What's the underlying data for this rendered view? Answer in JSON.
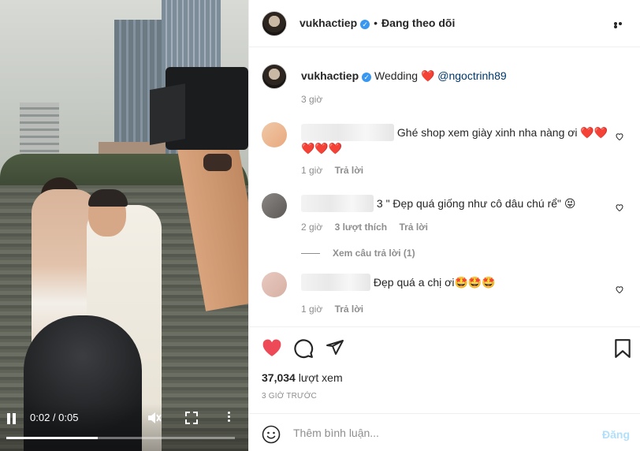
{
  "video": {
    "time_label": "0:02 / 0:05",
    "progress": 0.4
  },
  "header": {
    "username": "vukhactiep",
    "verified_mark": "✓",
    "separator": "•",
    "follow_label": "Đang theo dõi"
  },
  "caption": {
    "username": "vukhactiep",
    "text": "Wedding",
    "heart": "❤️",
    "mention": "@ngoctrinh89",
    "time": "3 giờ"
  },
  "comments": [
    {
      "tail": "Ghé shop xem giày xinh nha nàng ơi ❤️❤️",
      "line2": "❤️❤️❤️",
      "time": "1 giờ",
      "reply_label": "Trả lời"
    },
    {
      "tail": "3 \" Đẹp quá giống như cô dâu chú rể\" 😝",
      "time": "2 giờ",
      "likes": "3 lượt thích",
      "reply_label": "Trả lời",
      "view_replies": "Xem câu trả lời (1)"
    },
    {
      "tail": "Đẹp quá a chị ơi🤩🤩🤩",
      "time": "1 giờ",
      "reply_label": "Trả lời"
    }
  ],
  "stats": {
    "views": "37,034",
    "views_label": "lượt xem",
    "posted": "3 GIỜ TRƯỚC"
  },
  "add_comment": {
    "placeholder": "Thêm bình luận...",
    "post_label": "Đăng"
  },
  "colors": {
    "like_red": "#ed4956",
    "link_blue": "#00376b",
    "verified_blue": "#3897f0"
  }
}
